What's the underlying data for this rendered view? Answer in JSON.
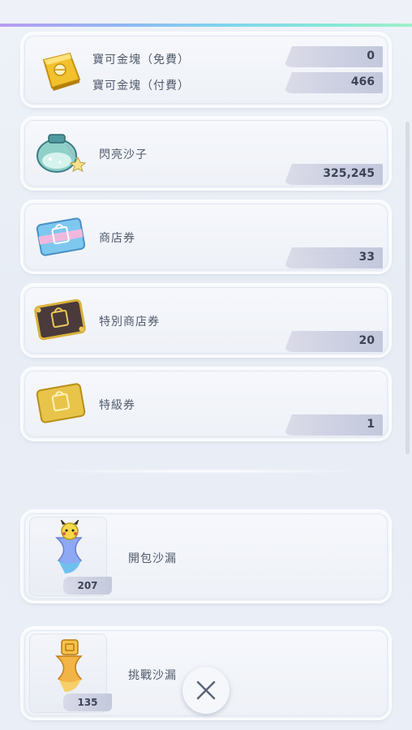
{
  "items": [
    {
      "label_1": "寶可金塊（免費）",
      "value_1": "0",
      "label_2": "寶可金塊（付費）",
      "value_2": "466",
      "icon": "gold-bar-icon"
    },
    {
      "label": "閃亮沙子",
      "value": "325,245",
      "icon": "shiny-sand-jar-icon"
    },
    {
      "label": "商店券",
      "value": "33",
      "icon": "shop-ticket-icon"
    },
    {
      "label": "特別商店券",
      "value": "20",
      "icon": "special-shop-ticket-icon"
    },
    {
      "label": "特級券",
      "value": "1",
      "icon": "premium-ticket-icon"
    }
  ],
  "hourglasses": [
    {
      "label": "開包沙漏",
      "count": "207",
      "icon": "pack-hourglass-icon"
    },
    {
      "label": "挑戰沙漏",
      "count": "135",
      "icon": "battle-hourglass-icon"
    }
  ],
  "close_icon": "close-icon"
}
